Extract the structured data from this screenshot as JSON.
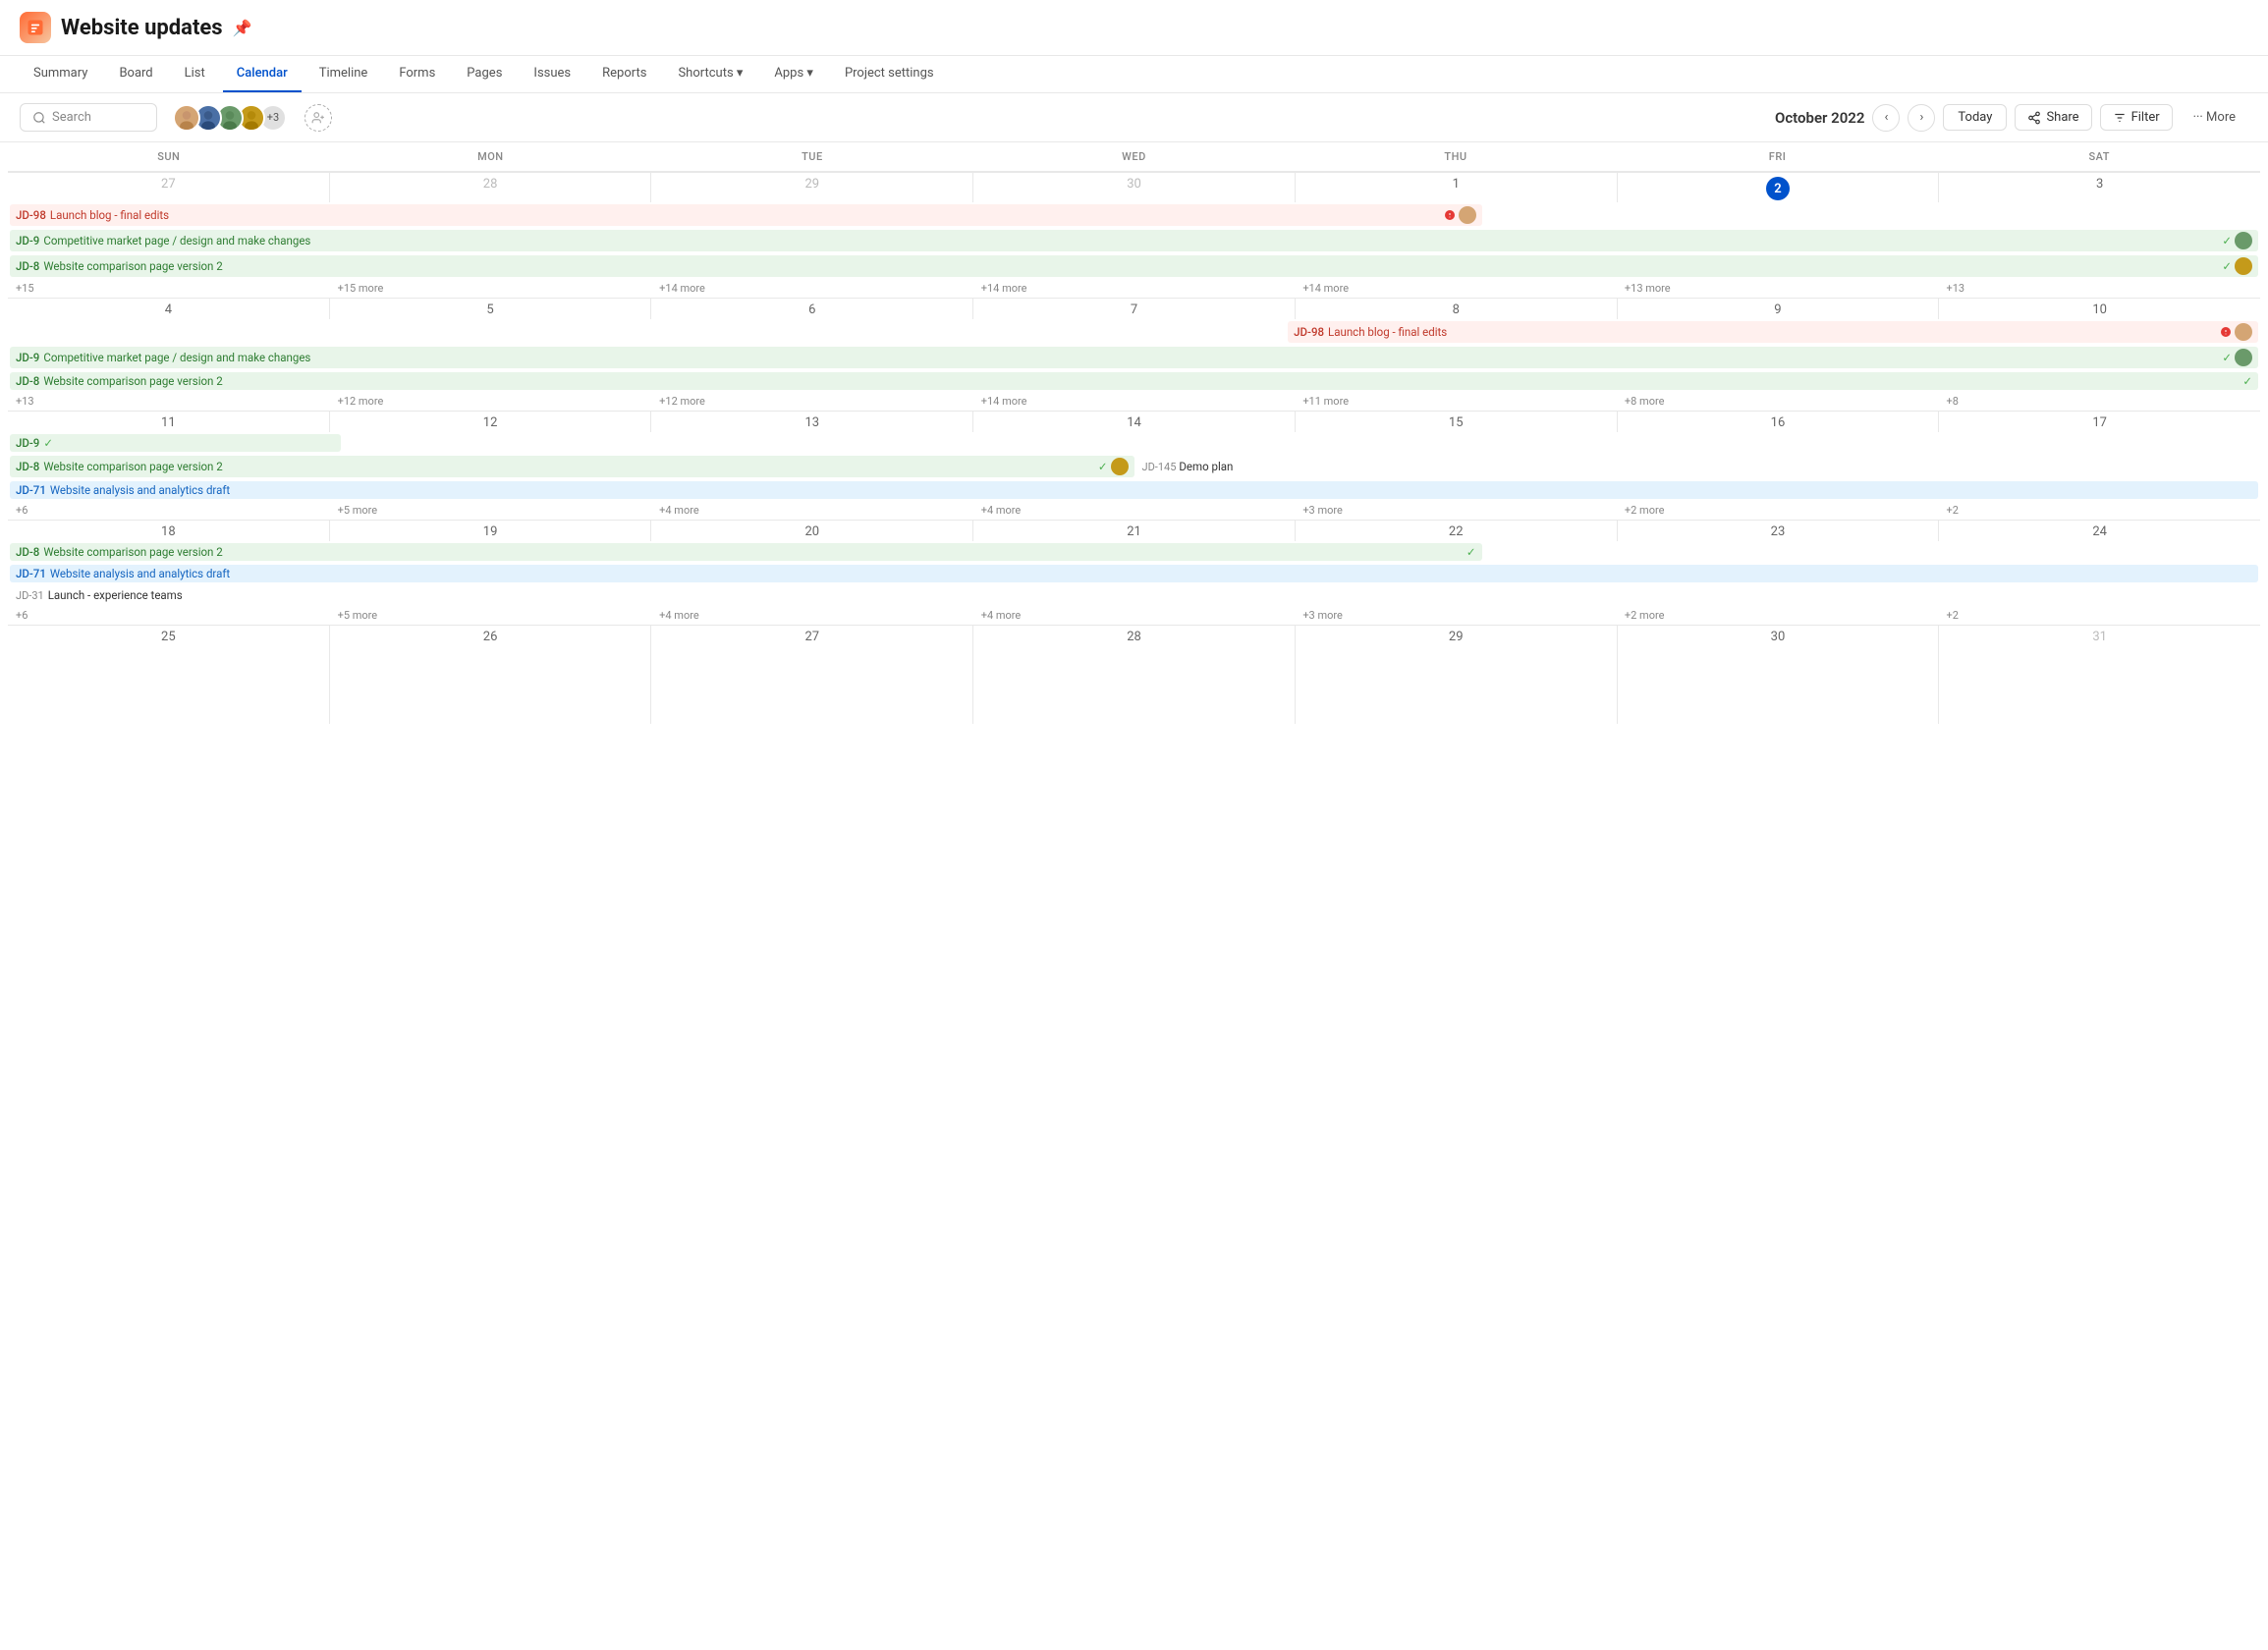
{
  "app": {
    "icon": "📋",
    "title": "Website updates",
    "pin_label": "📌"
  },
  "nav": {
    "items": [
      {
        "label": "Summary",
        "active": false
      },
      {
        "label": "Board",
        "active": false
      },
      {
        "label": "List",
        "active": false
      },
      {
        "label": "Calendar",
        "active": true
      },
      {
        "label": "Timeline",
        "active": false
      },
      {
        "label": "Forms",
        "active": false
      },
      {
        "label": "Pages",
        "active": false
      },
      {
        "label": "Issues",
        "active": false
      },
      {
        "label": "Reports",
        "active": false
      },
      {
        "label": "Shortcuts ▾",
        "active": false
      },
      {
        "label": "Apps ▾",
        "active": false
      },
      {
        "label": "Project settings",
        "active": false
      }
    ]
  },
  "toolbar": {
    "search_placeholder": "Search",
    "calendar_month": "October 2022",
    "today_label": "Today",
    "share_label": "Share",
    "filter_label": "Filter",
    "more_label": "··· More",
    "avatars_extra": "+3"
  },
  "calendar": {
    "days_of_week": [
      "SUN",
      "MON",
      "TUE",
      "WED",
      "THU",
      "FRI",
      "SAT"
    ],
    "weeks": [
      {
        "days": [
          {
            "num": "27",
            "other": true
          },
          {
            "num": "28",
            "other": true
          },
          {
            "num": "29",
            "other": true
          },
          {
            "num": "30",
            "other": true
          },
          {
            "num": "1"
          },
          {
            "num": "2",
            "today": true
          },
          {
            "num": "3"
          }
        ],
        "span_events": [
          {
            "id": "JD-98",
            "label": "Launch blog - final edits",
            "type": "red",
            "spans": [
              0,
              3
            ],
            "has_warning": true,
            "has_avatar": true
          },
          {
            "id": "JD-9",
            "label": "Competitive market page / design and make changes",
            "type": "green",
            "spans": [
              0,
              6
            ],
            "has_check": true,
            "has_avatar": true
          },
          {
            "id": "JD-8",
            "label": "Website comparison page version 2",
            "type": "green",
            "spans": [
              0,
              6
            ],
            "has_check": true,
            "has_avatar": true
          }
        ],
        "more": [
          "+15",
          "+15 more",
          "+14 more",
          "+14 more",
          "+14 more",
          "+13 more",
          "+13"
        ]
      },
      {
        "days": [
          {
            "num": "4"
          },
          {
            "num": "5"
          },
          {
            "num": "6"
          },
          {
            "num": "7"
          },
          {
            "num": "8"
          },
          {
            "num": "9"
          },
          {
            "num": "10"
          }
        ],
        "span_events": [
          {
            "id": "JD-98",
            "label": "Launch blog - final edits",
            "type": "red",
            "spans": [
              4,
              6
            ],
            "has_warning": true,
            "has_avatar": true
          },
          {
            "id": "JD-9",
            "label": "Competitive market page / design and make changes",
            "type": "green",
            "spans": [
              0,
              6
            ],
            "has_check": true,
            "has_avatar": true
          },
          {
            "id": "JD-8",
            "label": "Website comparison page version 2",
            "type": "green",
            "spans": [
              0,
              6
            ],
            "has_check": true
          }
        ],
        "more": [
          "+13",
          "+12 more",
          "+12 more",
          "+14 more",
          "+11 more",
          "+8 more",
          "+8"
        ]
      },
      {
        "days": [
          {
            "num": "11"
          },
          {
            "num": "12"
          },
          {
            "num": "13"
          },
          {
            "num": "14"
          },
          {
            "num": "15"
          },
          {
            "num": "16"
          },
          {
            "num": "17"
          }
        ],
        "span_events": [
          {
            "id": "JD-9",
            "label": "",
            "type": "green",
            "spans": [
              0,
              0
            ],
            "has_check": true,
            "check_only": true
          },
          {
            "id": "JD-8",
            "label": "Website comparison page version 2",
            "type": "green",
            "spans": [
              0,
              2
            ],
            "has_check": true,
            "has_avatar": true
          },
          {
            "id": "JD-71",
            "label": "Website analysis and analytics draft",
            "type": "blue",
            "spans": [
              0,
              6
            ]
          }
        ],
        "extra_events": [
          {
            "col": 5,
            "id": "JD-145",
            "label": "Demo plan",
            "type": "plain"
          }
        ],
        "more": [
          "+6",
          "+5 more",
          "+4 more",
          "+4 more",
          "+3 more",
          "+2 more",
          "+2"
        ]
      },
      {
        "days": [
          {
            "num": "18"
          },
          {
            "num": "19"
          },
          {
            "num": "20"
          },
          {
            "num": "21"
          },
          {
            "num": "22"
          },
          {
            "num": "23"
          },
          {
            "num": "24"
          }
        ],
        "span_events": [
          {
            "id": "JD-8",
            "label": "Website comparison page version 2",
            "type": "green",
            "spans": [
              0,
              4
            ],
            "has_check": true
          },
          {
            "id": "JD-71",
            "label": "Website analysis and analytics draft",
            "type": "blue",
            "spans": [
              0,
              6
            ]
          },
          {
            "id": "JD-31",
            "label": "Launch - experience teams",
            "type": "plain",
            "spans": [
              0,
              6
            ]
          }
        ],
        "more": [
          "+6",
          "+5 more",
          "+4 more",
          "+4 more",
          "+3 more",
          "+2 more",
          "+2"
        ]
      },
      {
        "days": [
          {
            "num": "25"
          },
          {
            "num": "26"
          },
          {
            "num": "27"
          },
          {
            "num": "28"
          },
          {
            "num": "29"
          },
          {
            "num": "30"
          },
          {
            "num": "31",
            "other": true
          }
        ],
        "span_events": [],
        "more": []
      }
    ]
  }
}
